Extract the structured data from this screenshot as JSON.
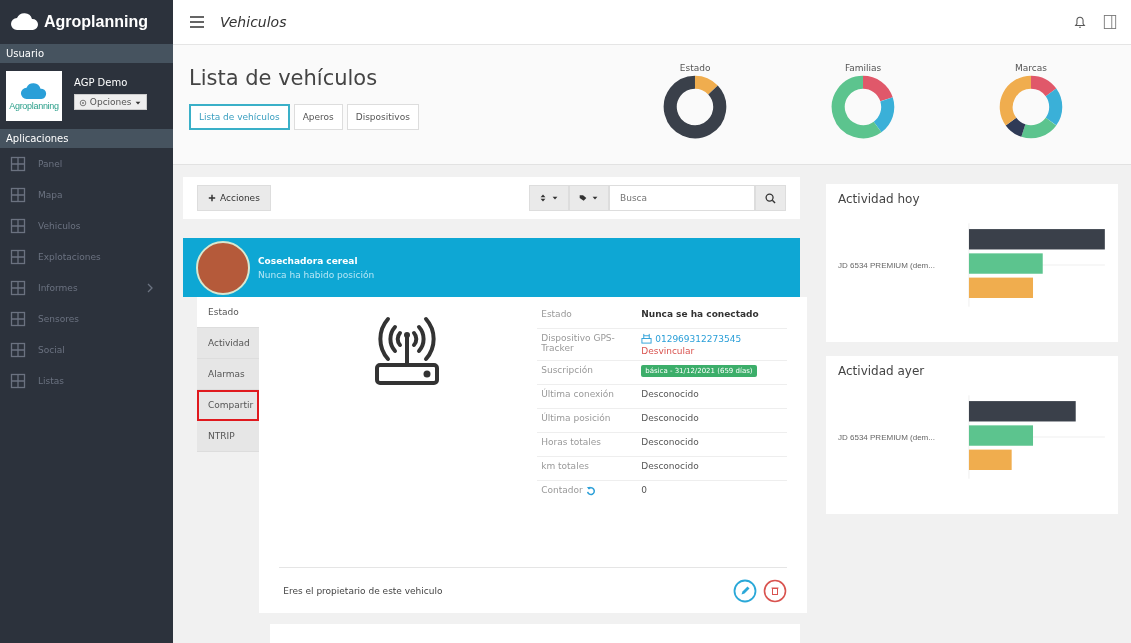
{
  "brand": {
    "name": "Agroplanning"
  },
  "sidebar": {
    "user_section": "Usuario",
    "user_name": "AGP Demo",
    "logo_caption": "Agroplanning",
    "options_button": "Opciones",
    "apps_section": "Aplicaciones",
    "items": [
      {
        "label": "Panel",
        "has_submenu": false
      },
      {
        "label": "Mapa",
        "has_submenu": false
      },
      {
        "label": "Vehiculos",
        "has_submenu": false
      },
      {
        "label": "Explotaciones",
        "has_submenu": false
      },
      {
        "label": "Informes",
        "has_submenu": true
      },
      {
        "label": "Sensores",
        "has_submenu": false
      },
      {
        "label": "Social",
        "has_submenu": false
      },
      {
        "label": "Listas",
        "has_submenu": false
      }
    ]
  },
  "topbar": {
    "title": "Vehiculos"
  },
  "header": {
    "title": "Lista de vehículos",
    "tabs": [
      {
        "label": "Lista de vehículos",
        "selected": true
      },
      {
        "label": "Aperos",
        "selected": false
      },
      {
        "label": "Dispositivos",
        "selected": false
      }
    ],
    "donuts": [
      {
        "title": "Estado"
      },
      {
        "title": "Familias"
      },
      {
        "title": "Marcas"
      }
    ]
  },
  "toolbar": {
    "actions_button": "Acciones",
    "search": {
      "placeholder": "Busca"
    }
  },
  "vehicle": {
    "name": "Cosechadora cereal",
    "subtitle": "Nunca ha habido posición",
    "tabs": [
      {
        "label": "Estado",
        "selected": true,
        "highlighted": false
      },
      {
        "label": "Actividad",
        "selected": false,
        "highlighted": false
      },
      {
        "label": "Alarmas",
        "selected": false,
        "highlighted": false
      },
      {
        "label": "Compartir",
        "selected": false,
        "highlighted": true
      },
      {
        "label": "NTRIP",
        "selected": false,
        "highlighted": false
      }
    ],
    "details": [
      {
        "kind": "text",
        "label": "Estado",
        "value": "Nunca se ha conectado"
      },
      {
        "kind": "device",
        "label": "Dispositivo GPS-Tracker",
        "value": "012969312273545",
        "action": "Desvincular"
      },
      {
        "kind": "badge",
        "label": "Suscripción",
        "value": "básica - 31/12/2021 (659 días)"
      },
      {
        "kind": "text",
        "label": "Última conexión",
        "value": "Desconocido"
      },
      {
        "kind": "text",
        "label": "Última posición",
        "value": "Desconocido"
      },
      {
        "kind": "text",
        "label": "Horas totales",
        "value": "Desconocido"
      },
      {
        "kind": "text",
        "label": "km totales",
        "value": "Desconocido"
      },
      {
        "kind": "counter",
        "label": "Contador",
        "value": "0"
      }
    ],
    "owner_note": "Eres el propietario de este vehiculo"
  },
  "activity": [
    {
      "title": "Actividad hoy",
      "label": "JD 6534 PREMIUM (dem..."
    },
    {
      "title": "Actividad ayer",
      "label": "JD 6534 PREMIUM (dem..."
    }
  ]
}
